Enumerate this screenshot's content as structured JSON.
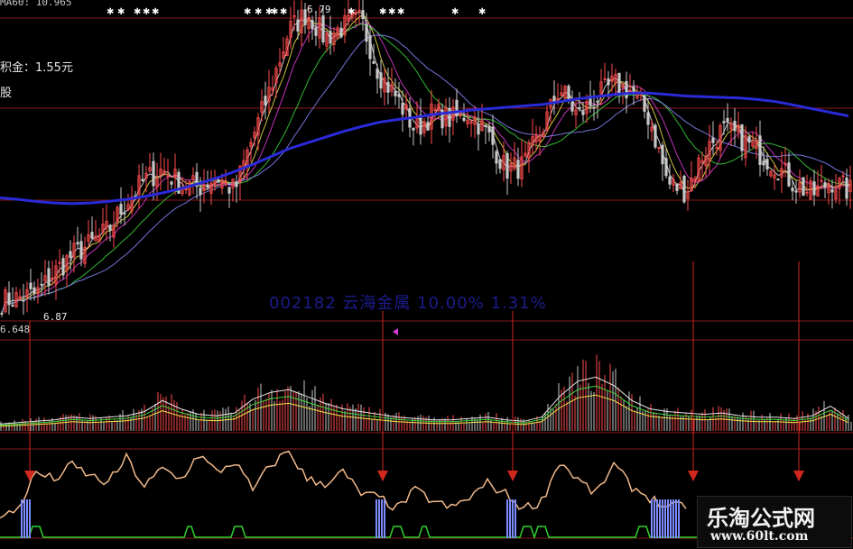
{
  "header": {
    "ma_info": "MA60: 10.965"
  },
  "labels": {
    "dividend": "积金：1.55元",
    "share_unit": "股",
    "high_price": "6.79",
    "low_price": "6.87",
    "volume_max": "6.648",
    "stock_ghost": "002182 云海金属 10.00% 1.31%"
  },
  "watermark": {
    "title": "乐淘公式网",
    "url": "www.60lt.com"
  },
  "colors": {
    "background": "#000000",
    "grid": "#8a1a1a",
    "ma_long": "#2a2ad8",
    "oscillator": "#f0b88a",
    "signal_arrow": "#d0281e",
    "bullish_candle": "#ff4c4c",
    "bearish_candle": "#c8c8c8",
    "signal_bar": "#7c8cff",
    "signal_line": "#2ed12e"
  },
  "chart_data": [
    {
      "type": "candlestick",
      "panel": "price",
      "x": [
        0,
        20,
        40,
        60,
        80,
        100,
        120,
        140,
        160,
        180,
        200,
        220,
        240,
        260,
        280,
        300,
        320,
        340,
        360,
        380,
        400,
        420,
        440,
        460,
        480,
        500,
        520,
        540,
        560,
        580,
        600,
        620,
        640,
        660,
        680,
        700,
        720,
        740,
        760,
        780,
        800,
        820,
        840,
        860,
        880,
        900,
        920,
        940
      ],
      "close": [
        6.9,
        6.95,
        7.0,
        7.3,
        7.55,
        7.7,
        7.9,
        8.3,
        8.6,
        8.75,
        8.55,
        8.5,
        8.65,
        8.45,
        9.2,
        9.9,
        10.7,
        10.95,
        10.6,
        10.75,
        10.85,
        10.1,
        9.75,
        9.3,
        9.55,
        9.45,
        9.55,
        9.25,
        8.75,
        8.8,
        9.3,
        9.9,
        9.5,
        9.75,
        9.95,
        9.85,
        9.45,
        8.55,
        8.45,
        9.0,
        9.3,
        9.2,
        9.0,
        8.8,
        8.55,
        8.4,
        8.6,
        8.45
      ],
      "series": [
        {
          "name": "",
          "color": "#2a2ad8",
          "values": [
            8.35,
            8.33,
            8.3,
            8.28,
            8.27,
            8.28,
            8.3,
            8.33,
            8.37,
            8.42,
            8.48,
            8.55,
            8.63,
            8.72,
            8.82,
            8.93,
            9.04,
            9.12,
            9.2,
            9.28,
            9.35,
            9.41,
            9.45,
            9.48,
            9.52,
            9.55,
            9.58,
            9.6,
            9.62,
            9.64,
            9.66,
            9.7,
            9.74,
            9.77,
            9.8,
            9.82,
            9.82,
            9.8,
            9.78,
            9.77,
            9.76,
            9.75,
            9.73,
            9.7,
            9.65,
            9.6,
            9.55,
            9.5
          ]
        }
      ],
      "high_marker": 6.79,
      "low_marker": 6.87
    },
    {
      "type": "bar",
      "panel": "volume",
      "max_label": 6.648,
      "values": [
        0.5,
        0.6,
        0.7,
        0.8,
        1.0,
        0.9,
        1.0,
        1.1,
        1.4,
        2.2,
        1.6,
        1.2,
        1.1,
        1.3,
        2.3,
        2.8,
        3.0,
        2.5,
        2.0,
        1.6,
        1.4,
        1.2,
        1.0,
        0.9,
        0.8,
        0.8,
        0.9,
        1.0,
        0.8,
        0.7,
        1.0,
        2.5,
        3.6,
        3.9,
        3.3,
        2.2,
        1.6,
        1.4,
        1.3,
        1.2,
        1.3,
        1.1,
        1.0,
        1.0,
        0.9,
        1.1,
        1.8,
        0.9
      ]
    },
    {
      "type": "line",
      "panel": "oscillator",
      "values": [
        5,
        20,
        70,
        60,
        80,
        65,
        55,
        90,
        50,
        75,
        60,
        95,
        70,
        85,
        45,
        80,
        100,
        60,
        55,
        70,
        40,
        35,
        20,
        45,
        30,
        20,
        35,
        55,
        40,
        20,
        30,
        85,
        60,
        40,
        80,
        50,
        35,
        20,
        25,
        60,
        55,
        50,
        45,
        35,
        45,
        40,
        30,
        35
      ],
      "signal_bars_at": [
        30,
        423,
        568,
        738
      ],
      "arrows_at": [
        33,
        424,
        568,
        768,
        885
      ]
    }
  ]
}
